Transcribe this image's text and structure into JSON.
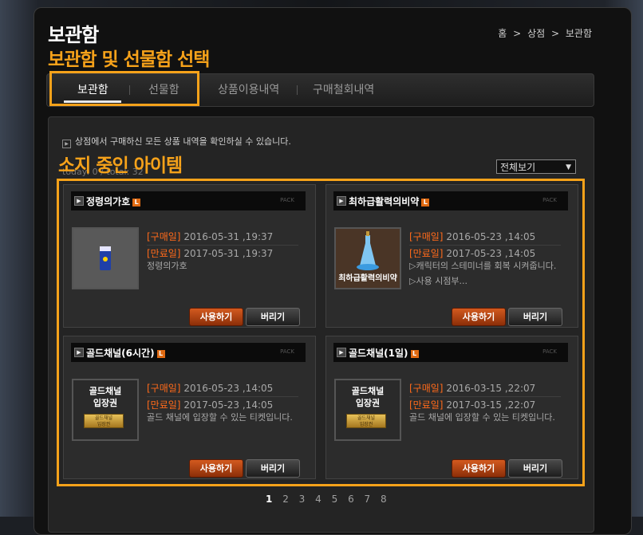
{
  "page": {
    "title": "보관함",
    "breadcrumb": [
      "홈",
      "상점",
      "보관함"
    ],
    "annotation_top": "보관함 및 선물함 선택",
    "annotation_items": "소지 중인 아이템"
  },
  "tabs": [
    {
      "label": "보관함",
      "active": true
    },
    {
      "label": "선물함",
      "active": false
    },
    {
      "label": "상품이용내역",
      "active": false
    },
    {
      "label": "구매철회내역",
      "active": false
    }
  ],
  "notice": "상점에서 구매하신 모든 상품 내역을 확인하실 수 있습니다.",
  "counts": "today: 0 / total: 32",
  "filter": {
    "selected": "전체보기"
  },
  "badge_letter": "L",
  "pack_label": "PACK",
  "labels": {
    "purchase": "[구매일]",
    "expire": "[만료일]",
    "use": "사용하기",
    "drop": "버리기"
  },
  "items": [
    {
      "name": "정령의가호",
      "purchase": "2016-05-31 ,19:37",
      "expire": "2017-05-31 ,19:37",
      "desc": "정령의가호",
      "thumb_text": ""
    },
    {
      "name": "최하급활력의비약",
      "purchase": "2016-05-23 ,14:05",
      "expire": "2017-05-23 ,14:05",
      "desc": "▷캐릭터의 스테미너를 회복 시켜줍니다.\n▷사용 시점부...",
      "thumb_text": "최하급활력의비약"
    },
    {
      "name": "골드채널(6시간)",
      "purchase": "2016-05-23 ,14:05",
      "expire": "2017-05-23 ,14:05",
      "desc": "골드 채널에 입장할 수 있는 티켓입니다.",
      "thumb_text": "골드채널\n입장권"
    },
    {
      "name": "골드채널(1일)",
      "purchase": "2016-03-15 ,22:07",
      "expire": "2017-03-15 ,22:07",
      "desc": "골드 채널에 입장할 수 있는 티켓입니다.",
      "thumb_text": "골드채널\n입장권"
    }
  ],
  "ticket_stamp": "골드채널\n입장권",
  "pagination": {
    "pages": [
      "1",
      "2",
      "3",
      "4",
      "5",
      "6",
      "7",
      "8"
    ],
    "current": "1"
  },
  "colors": {
    "accent_annotation": "#f6a21a",
    "date_label": "#ff6a1a",
    "use_button": "#c4501a"
  }
}
